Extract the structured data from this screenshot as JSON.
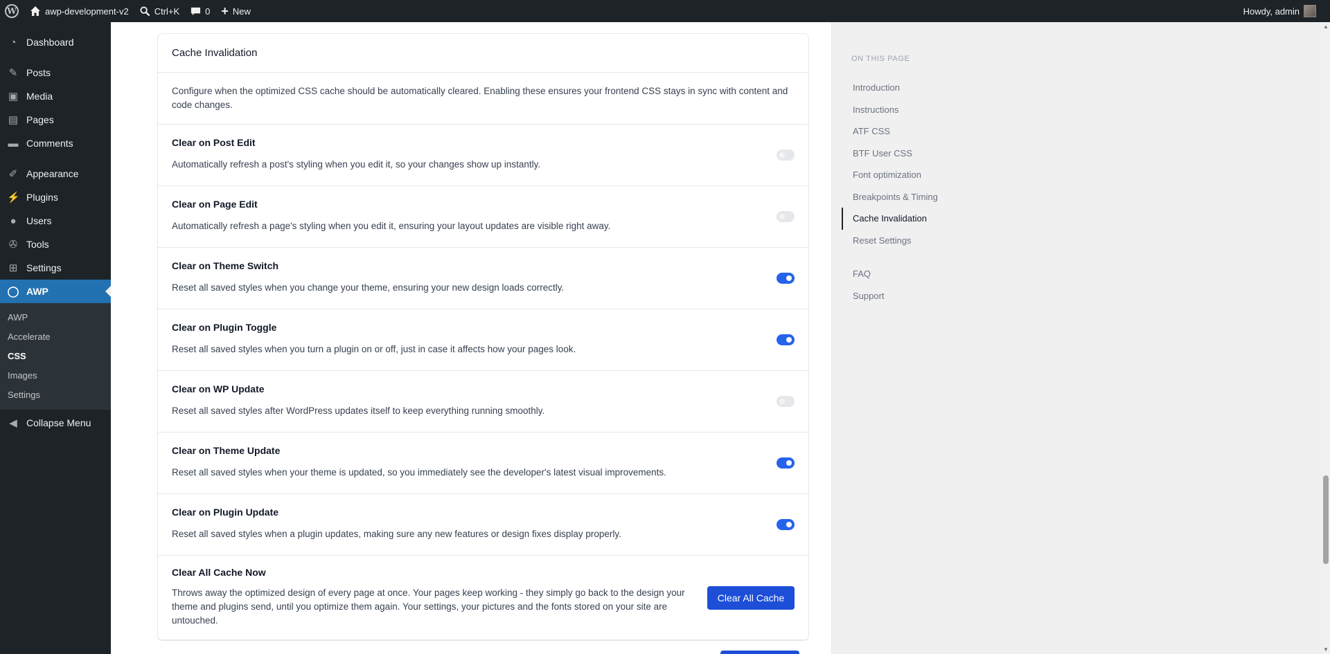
{
  "adminbar": {
    "site_name": "awp-development-v2",
    "search_shortcut": "Ctrl+K",
    "comments_count": "0",
    "new_label": "New",
    "howdy": "Howdy, admin"
  },
  "sidebar": {
    "items": [
      {
        "label": "Dashboard",
        "icon": "dashboard-icon"
      },
      {
        "label": "Posts",
        "icon": "pin-icon"
      },
      {
        "label": "Media",
        "icon": "media-icon"
      },
      {
        "label": "Pages",
        "icon": "page-icon"
      },
      {
        "label": "Comments",
        "icon": "comment-icon"
      },
      {
        "label": "Appearance",
        "icon": "brush-icon"
      },
      {
        "label": "Plugins",
        "icon": "plug-icon"
      },
      {
        "label": "Users",
        "icon": "user-icon"
      },
      {
        "label": "Tools",
        "icon": "wrench-icon"
      },
      {
        "label": "Settings",
        "icon": "sliders-icon"
      },
      {
        "label": "AWP",
        "icon": "circle-icon"
      }
    ],
    "submenu": [
      "AWP",
      "Accelerate",
      "CSS",
      "Images",
      "Settings"
    ],
    "collapse": "Collapse Menu"
  },
  "card": {
    "title": "Cache Invalidation",
    "description": "Configure when the optimized CSS cache should be automatically cleared. Enabling these ensures your frontend CSS stays in sync with content and code changes.",
    "rows": [
      {
        "title": "Clear on Post Edit",
        "desc": "Automatically refresh a post's styling when you edit it, so your changes show up instantly.",
        "enabled": false
      },
      {
        "title": "Clear on Page Edit",
        "desc": "Automatically refresh a page's styling when you edit it, ensuring your layout updates are visible right away.",
        "enabled": false
      },
      {
        "title": "Clear on Theme Switch",
        "desc": "Reset all saved styles when you change your theme, ensuring your new design loads correctly.",
        "enabled": true
      },
      {
        "title": "Clear on Plugin Toggle",
        "desc": "Reset all saved styles when you turn a plugin on or off, just in case it affects how your pages look.",
        "enabled": true
      },
      {
        "title": "Clear on WP Update",
        "desc": "Reset all saved styles after WordPress updates itself to keep everything running smoothly.",
        "enabled": false
      },
      {
        "title": "Clear on Theme Update",
        "desc": "Reset all saved styles when your theme is updated, so you immediately see the developer's latest visual improvements.",
        "enabled": true
      },
      {
        "title": "Clear on Plugin Update",
        "desc": "Reset all saved styles when a plugin updates, making sure any new features or design fixes display properly.",
        "enabled": true
      }
    ],
    "clear_all": {
      "title": "Clear All Cache Now",
      "desc": "Throws away the optimized design of every page at once. Your pages keep working - they simply go back to the design your theme and plugins send, until you optimize them again. Your settings, your pictures and the fonts stored on your site are untouched.",
      "button": "Clear All Cache"
    }
  },
  "toc": {
    "title": "ON THIS PAGE",
    "items": [
      "Introduction",
      "Instructions",
      "ATF CSS",
      "BTF User CSS",
      "Font optimization",
      "Breakpoints & Timing",
      "Cache Invalidation",
      "Reset Settings"
    ],
    "extra": [
      "FAQ",
      "Support"
    ]
  },
  "colors": {
    "accent": "#2563eb",
    "admin_dark": "#1d2327",
    "menu_current": "#2271b1"
  }
}
